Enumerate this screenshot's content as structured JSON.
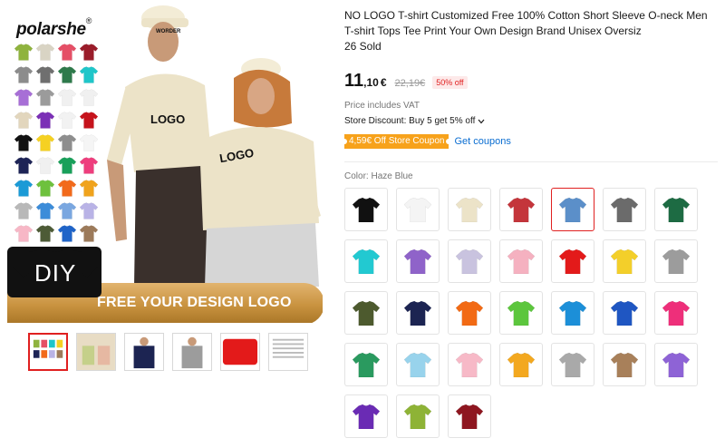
{
  "brand": {
    "name": "polarshe",
    "mark": "®"
  },
  "main_image": {
    "diy_label": "DIY",
    "banner_text": "FREE YOUR DESIGN LOGO",
    "logo_text": "LOGO",
    "cap_text": "WORDER"
  },
  "mini_swatches": [
    "#8fb33e",
    "#d9d4c4",
    "#e54f66",
    "#9a1c2a",
    "#8c8c8c",
    "#6f6f6f",
    "#2e7a4b",
    "#1fc6c9",
    "#a76fd6",
    "#9b9b9b",
    "#f0f0f0",
    "#f0f0f0",
    "#e2d6bd",
    "#7b2fb6",
    "#f2f2f2",
    "#c6131c",
    "#111111",
    "#f5d122",
    "#8e8e8e",
    "#f5f5f5",
    "#1d2456",
    "#f0f0f0",
    "#19a05a",
    "#ee3e7d",
    "#1b9ad6",
    "#6ec13d",
    "#f26a1b",
    "#f0a31c",
    "#b8b8b8",
    "#3c8cd9",
    "#7aa7e0",
    "#b9b3e6",
    "#f7b7c6",
    "#4d5b36",
    "#1f64c8",
    "#9c7a5a"
  ],
  "thumbnails": [
    {
      "name": "thumb-swatch-collage",
      "active": true
    },
    {
      "name": "thumb-couple-beige",
      "active": false
    },
    {
      "name": "thumb-man-navy",
      "active": false
    },
    {
      "name": "thumb-man-grey",
      "active": false
    },
    {
      "name": "thumb-red-folded",
      "active": false
    },
    {
      "name": "thumb-size-chart",
      "active": false
    }
  ],
  "product": {
    "title": "NO LOGO T-shirt Customized Free 100% Cotton Short Sleeve O-neck Men T-shirt Tops Tee Print Your Own Design Brand Unisex Oversiz",
    "sold": "26 Sold",
    "price_int": "11",
    "price_dec": ",10",
    "price_cur": "€",
    "price_old": "22,19€",
    "discount": "50% off",
    "vat_note": "Price includes VAT",
    "store_discount": "Store Discount: Buy 5 get 5% off",
    "coupon_badge": "4,59€ Off Store Coupon",
    "get_coupons": "Get coupons",
    "color_label": "Color:",
    "color_value": "Haze Blue"
  },
  "colors": {
    "accent": "#e02020",
    "link": "#0a6dd1",
    "coupon": "#f7a21b",
    "options": [
      {
        "color": "#111111",
        "selected": false
      },
      {
        "color": "#f4f4f4",
        "selected": false
      },
      {
        "color": "#ece3c8",
        "selected": false
      },
      {
        "color": "#c4353b",
        "selected": false
      },
      {
        "color": "#5b8fc9",
        "selected": true
      },
      {
        "color": "#6b6b6b",
        "selected": false
      },
      {
        "color": "#1d6b43",
        "selected": false
      },
      {
        "color": "#22c9d1",
        "selected": false
      },
      {
        "color": "#8f63c9",
        "selected": false
      },
      {
        "color": "#c9c3df",
        "selected": false
      },
      {
        "color": "#f5b1c0",
        "selected": false
      },
      {
        "color": "#e31a1a",
        "selected": false
      },
      {
        "color": "#f3cf2a",
        "selected": false
      },
      {
        "color": "#9c9c9c",
        "selected": false
      },
      {
        "color": "#4d5a2e",
        "selected": false
      },
      {
        "color": "#1c2452",
        "selected": false
      },
      {
        "color": "#f26a14",
        "selected": false
      },
      {
        "color": "#5cc63d",
        "selected": false
      },
      {
        "color": "#1c8fd8",
        "selected": false
      },
      {
        "color": "#1f56c2",
        "selected": false
      },
      {
        "color": "#ee2f7a",
        "selected": false
      },
      {
        "color": "#2a9a5f",
        "selected": false
      },
      {
        "color": "#98d3ec",
        "selected": false
      },
      {
        "color": "#f7b9c7",
        "selected": false
      },
      {
        "color": "#f3a81f",
        "selected": false
      },
      {
        "color": "#a9a9a9",
        "selected": false
      },
      {
        "color": "#a8805a",
        "selected": false
      },
      {
        "color": "#8e63d6",
        "selected": false
      },
      {
        "color": "#6a2bb4",
        "selected": false
      },
      {
        "color": "#8eb336",
        "selected": false
      },
      {
        "color": "#8e1620",
        "selected": false
      }
    ]
  }
}
